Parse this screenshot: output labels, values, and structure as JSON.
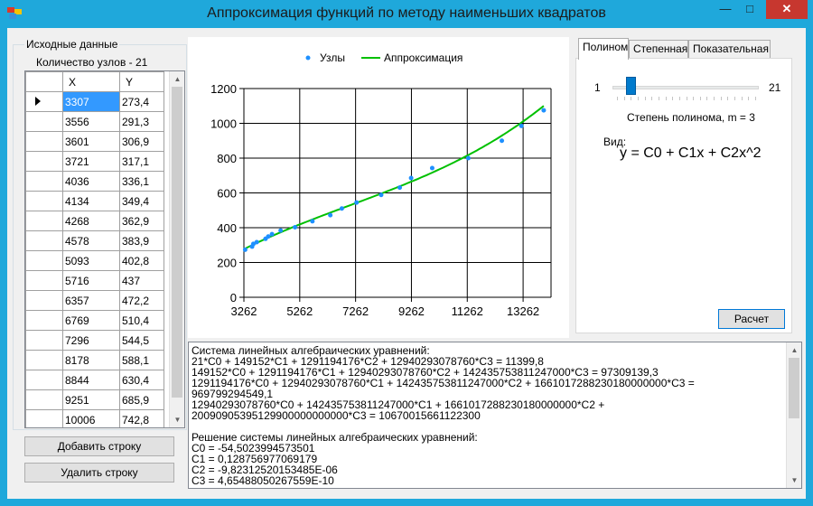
{
  "window": {
    "title": "Аппроксимация функций по методу наименьших квадратов",
    "minimize": "—",
    "maximize": "□",
    "close": "✕",
    "accent": "#1fa8db"
  },
  "data_group": {
    "caption": "Исходные данные",
    "node_count_label": "Количество узлов - 21"
  },
  "grid": {
    "columns": [
      "X",
      "Y"
    ],
    "rows": [
      {
        "x": "3307",
        "y": "273,4"
      },
      {
        "x": "3556",
        "y": "291,3"
      },
      {
        "x": "3601",
        "y": "306,9"
      },
      {
        "x": "3721",
        "y": "317,1"
      },
      {
        "x": "4036",
        "y": "336,1"
      },
      {
        "x": "4134",
        "y": "349,4"
      },
      {
        "x": "4268",
        "y": "362,9"
      },
      {
        "x": "4578",
        "y": "383,9"
      },
      {
        "x": "5093",
        "y": "402,8"
      },
      {
        "x": "5716",
        "y": "437"
      },
      {
        "x": "6357",
        "y": "472,2"
      },
      {
        "x": "6769",
        "y": "510,4"
      },
      {
        "x": "7296",
        "y": "544,5"
      },
      {
        "x": "8178",
        "y": "588,1"
      },
      {
        "x": "8844",
        "y": "630,4"
      },
      {
        "x": "9251",
        "y": "685,9"
      },
      {
        "x": "10006",
        "y": "742,8"
      }
    ],
    "selected_color": "#3399ff"
  },
  "buttons": {
    "add_row": "Добавить строку",
    "delete_row": "Удалить строку",
    "calculate": "Расчет"
  },
  "tabs": [
    "Полином",
    "Степенная",
    "Показательная"
  ],
  "active_tab": "Полином",
  "polynomial": {
    "slider_min": "1",
    "slider_max": "21",
    "slider_value": 3,
    "degree_label": "Степень полинома, m = 3",
    "form_label": "Вид:",
    "formula": "y = C0 + C1x + C2x^2"
  },
  "chart_data": {
    "type": "scatter",
    "legend": [
      "Узлы",
      "Аппроксимация"
    ],
    "legend_position": "top",
    "grid": true,
    "xlim": [
      3262,
      14262
    ],
    "ylim": [
      0,
      1200
    ],
    "x_ticks": [
      "3262",
      "5262",
      "7262",
      "9262",
      "11262",
      "13262"
    ],
    "y_ticks": [
      "0",
      "200",
      "400",
      "600",
      "800",
      "1000",
      "1200"
    ],
    "series": [
      {
        "name": "Узлы",
        "color": "#1e90ff",
        "points": [
          [
            3307,
            273.4
          ],
          [
            3556,
            291.3
          ],
          [
            3601,
            306.9
          ],
          [
            3721,
            317.1
          ],
          [
            4036,
            336.1
          ],
          [
            4134,
            349.4
          ],
          [
            4268,
            362.9
          ],
          [
            4578,
            383.9
          ],
          [
            5093,
            402.8
          ],
          [
            5716,
            437
          ],
          [
            6357,
            472.2
          ],
          [
            6769,
            510.4
          ],
          [
            7296,
            544.5
          ],
          [
            8178,
            588.1
          ],
          [
            8844,
            630.4
          ],
          [
            9251,
            685.9
          ],
          [
            10006,
            742.8
          ],
          [
            11300,
            800
          ],
          [
            12500,
            900
          ],
          [
            13200,
            985
          ],
          [
            14000,
            1075
          ]
        ]
      },
      {
        "name": "Аппроксимация",
        "color": "#00c000",
        "coefficients": [
          -54.5023994573501,
          0.128756977069179,
          -9.82312520153485e-06,
          4.65488050267559e-10
        ]
      }
    ]
  },
  "output_text": "Система линейных алгебраических уравнений:\n21*C0 + 149152*C1 + 1291194176*C2 + 12940293078760*C3 = 11399,8\n149152*C0 + 1291194176*C1 + 12940293078760*C2 + 142435753811247000*C3 = 97309139,3\n1291194176*C0 + 12940293078760*C1 + 142435753811247000*C2 + 1661017288230180000000*C3 = 969799294549,1\n12940293078760*C0 + 142435753811247000*C1 + 1661017288230180000000*C2 + 20090905395129900000000000*C3 = 10670015661122300\n\nРешение системы линейных алгебраических уравнений:\nC0 = -54,5023994573501\nC1 = 0,128756977069179\nC2 = -9,82312520153485E-06\nC3 = 4,65488050267559E-10"
}
